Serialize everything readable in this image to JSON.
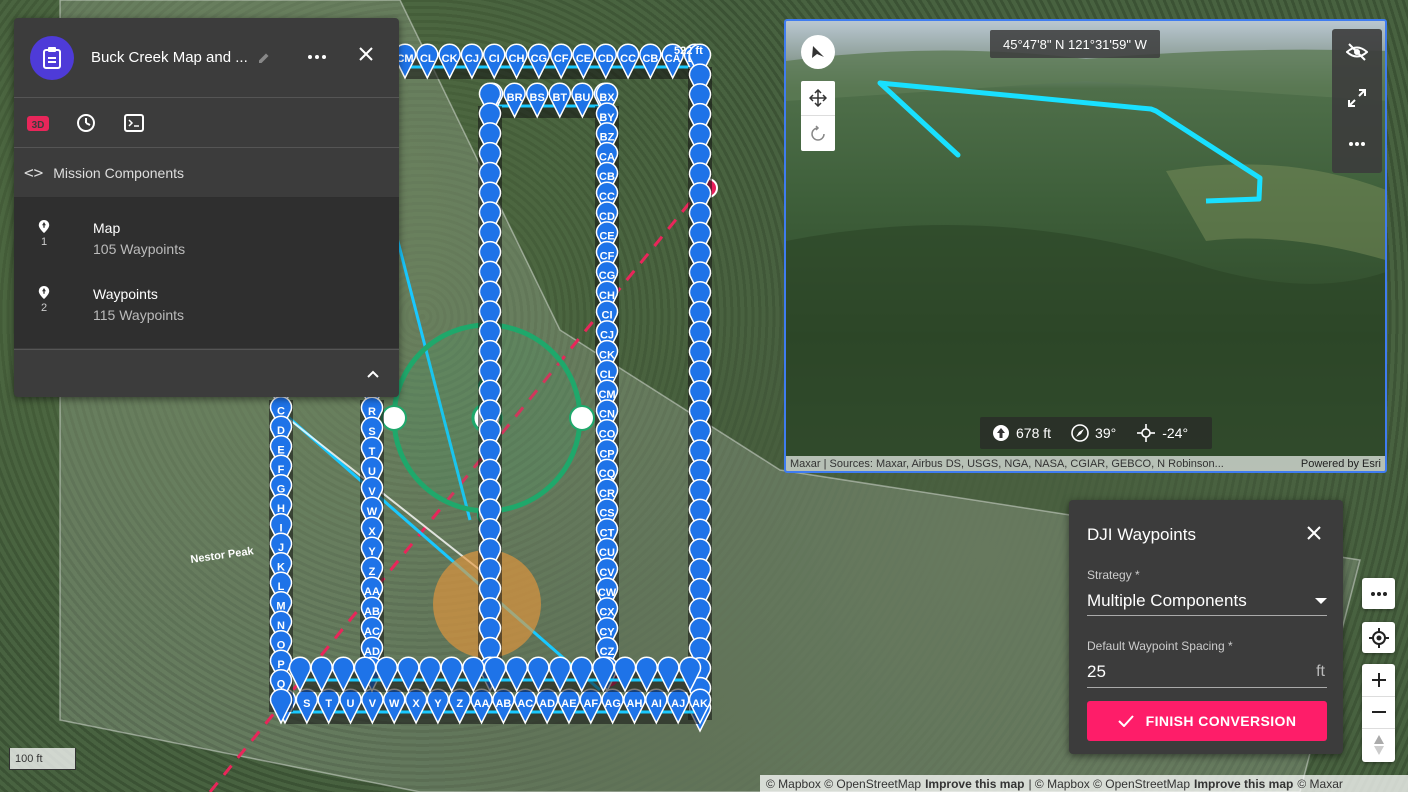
{
  "mission": {
    "title": "Buck Creek Map and ...",
    "section_label": "Mission Components",
    "components": [
      {
        "number": "1",
        "name": "Map",
        "detail": "105 Waypoints"
      },
      {
        "number": "2",
        "name": "Waypoints",
        "detail": "115 Waypoints"
      }
    ],
    "tab_icons": [
      "3d-icon",
      "history-icon",
      "terminal-icon"
    ]
  },
  "view3d": {
    "coordinates": "45°47'8\" N 121°31'59\" W",
    "altitude": "678 ft",
    "heading": "39°",
    "gimbal": "-24°",
    "attribution_sources": "Maxar | Sources: Maxar, Airbus DS, USGS, NGA, NASA, CGIAR, GEBCO, N Robinson...",
    "attribution_powered": "Powered by Esri"
  },
  "dji_panel": {
    "title": "DJI Waypoints",
    "strategy_label": "Strategy *",
    "strategy_value": "Multiple Components",
    "spacing_label": "Default Waypoint Spacing *",
    "spacing_value": "25",
    "spacing_unit": "ft",
    "finish_label": "FINISH CONVERSION"
  },
  "map": {
    "place_label": "Nestor Peak",
    "scale_label": "100 ft",
    "marker_2_label": "2",
    "top_ft_label": "522 ft",
    "top_row_labels": [
      "CM",
      "CL",
      "CK",
      "CJ",
      "CI",
      "CH",
      "CG",
      "CF",
      "CE",
      "CD",
      "CC",
      "CB",
      "CA",
      "BZ",
      "BY",
      "BX"
    ],
    "inner_top_labels": [
      "BQ",
      "BR",
      "BS",
      "BT",
      "BU",
      "BV"
    ],
    "inner_right_labels": [
      "BX",
      "BY",
      "BZ",
      "CA",
      "CB",
      "CC",
      "CD",
      "CE",
      "CF",
      "CG",
      "CH",
      "CI",
      "CJ",
      "CK",
      "CL",
      "CM",
      "CN",
      "CO",
      "CP",
      "CQ",
      "CR",
      "CS",
      "CT",
      "CU",
      "CV",
      "CW",
      "CX",
      "CY",
      "CZ"
    ],
    "left_col_labels": [
      "B",
      "C",
      "D",
      "E",
      "F",
      "G",
      "H",
      "I",
      "J",
      "K",
      "L",
      "M",
      "N",
      "O",
      "P",
      "Q"
    ],
    "mid_col_labels": [
      "Q",
      "R",
      "S",
      "T",
      "U",
      "V",
      "W",
      "X",
      "Y",
      "Z",
      "AA",
      "AB",
      "AC",
      "AD"
    ],
    "bottom_row_labels": [
      "R",
      "S",
      "T",
      "U",
      "V",
      "W",
      "X",
      "Y",
      "Z",
      "AA",
      "AB",
      "AC",
      "AD",
      "AE",
      "AF",
      "AG",
      "AH",
      "AI",
      "AJ",
      "AK",
      "AL",
      "AM",
      "AN"
    ]
  },
  "attribution": {
    "part1": "© Mapbox © OpenStreetMap",
    "improve1": "Improve this map",
    "part2": "| © Mapbox © OpenStreetMap",
    "improve2": "Improve this map",
    "part3": "© Maxar"
  },
  "colors": {
    "accent": "#fe1d69",
    "waypoint": "#1e73e8",
    "path": "#19e0ff",
    "panel": "#3c3c3c",
    "avatar": "#4e3bd8"
  }
}
